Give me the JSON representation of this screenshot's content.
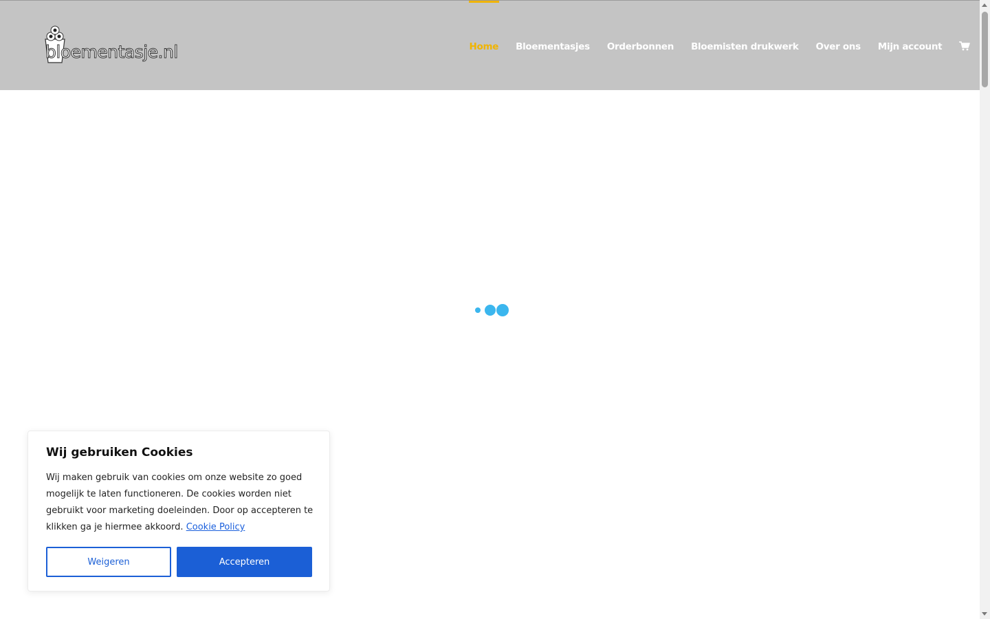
{
  "header": {
    "logo_text": "bloementasje.nl",
    "nav": [
      {
        "label": "Home",
        "active": true
      },
      {
        "label": "Bloementasjes",
        "active": false
      },
      {
        "label": "Orderbonnen",
        "active": false
      },
      {
        "label": "Bloemisten drukwerk",
        "active": false
      },
      {
        "label": "Over ons",
        "active": false
      },
      {
        "label": "Mijn account",
        "active": false
      }
    ],
    "cart_icon": "shopping-cart-icon"
  },
  "loader": {
    "icon": "loading-dots-icon"
  },
  "cookie": {
    "title": "Wij gebruiken Cookies",
    "text": "Wij maken gebruik van cookies om onze website zo goed mogelijk te laten functioneren. De cookies worden niet gebruikt voor marketing doeleinden. Door op accepteren te klikken ga je hiermee akkoord.",
    "link_label": "Cookie Policy",
    "refuse_label": "Weigeren",
    "accept_label": "Accepteren"
  },
  "colors": {
    "header_bg": "#c4c4c4",
    "nav_active": "#f0b400",
    "accent_blue": "#1b5fd6",
    "loader": "#3bb6ee"
  }
}
